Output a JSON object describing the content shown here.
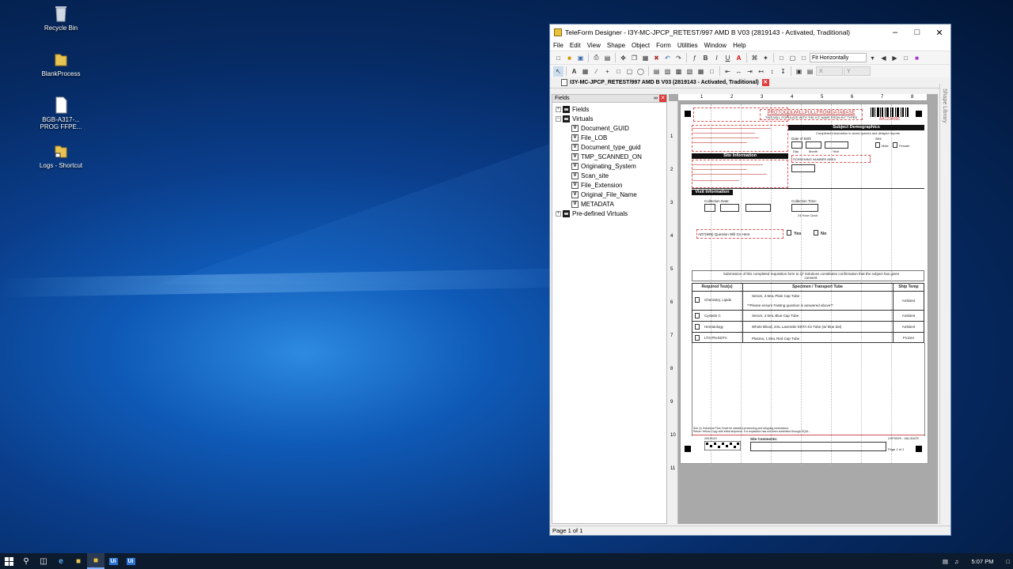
{
  "desktop": {
    "icons": [
      {
        "label": "Recycle Bin"
      },
      {
        "label": "BlankProcess"
      },
      {
        "label": "BGB-A317-... PROG FFPE..."
      },
      {
        "label": "Logs - Shortcut"
      }
    ]
  },
  "window": {
    "title": "TeleForm Designer - I3Y-MC-JPCP_RETEST/997 AMD B V03 (2819143 - Activated, Traditional)",
    "menu": [
      "File",
      "Edit",
      "View",
      "Shape",
      "Object",
      "Form",
      "Utilities",
      "Window",
      "Help"
    ],
    "zoom": "Fit Horizontally",
    "x_label": "X",
    "y_label": "Y",
    "doc_tab": "I3Y-MC-JPCP_RETEST/997 AMD B V03 (2819143 - Activated, Traditional)",
    "status": "Page 1 of 1",
    "shape_library": "Shape Library"
  },
  "fields_panel": {
    "title": "Fields",
    "tree": [
      {
        "label": "Fields",
        "type": "group"
      },
      {
        "label": "Virtuals",
        "type": "group"
      },
      {
        "label": "Document_GUID",
        "type": "virtual"
      },
      {
        "label": "File_LOB",
        "type": "virtual"
      },
      {
        "label": "Document_type_guid",
        "type": "virtual"
      },
      {
        "label": "TMP_SCANNED_ON",
        "type": "virtual"
      },
      {
        "label": "Originating_System",
        "type": "virtual"
      },
      {
        "label": "Scan_site",
        "type": "virtual"
      },
      {
        "label": "File_Extension",
        "type": "virtual"
      },
      {
        "label": "Original_File_Name",
        "type": "virtual"
      },
      {
        "label": "METADATA",
        "type": "virtual"
      },
      {
        "label": "Pre-defined Virtuals",
        "type": "group"
      }
    ]
  },
  "ruler": {
    "h": [
      "1",
      "2",
      "3",
      "4",
      "5",
      "6",
      "7",
      "8"
    ],
    "v": [
      "1",
      "2",
      "3",
      "4",
      "5",
      "6",
      "7",
      "8",
      "9",
      "10",
      "11"
    ]
  },
  "form": {
    "protocol": "PROTOCOLWILLPULLFROMDATABASE",
    "kit_note": "THIS WILL POPULATE WITH THE KIT NAME FROM KIT TYPES",
    "barcode_text": "AA1234566",
    "subject_demographics": "Subject Demographics",
    "demo_note": "Completed information to avoid queries and delayed reports",
    "dob": "Date of Birth",
    "dob_parts": [
      "Day",
      "Month",
      "Year"
    ],
    "sex": "Sex",
    "male": "Male",
    "female": "Female",
    "site_information": "Site Information",
    "screening": "SCREENING NUMBER AREA",
    "visit_information": "Visit Information",
    "collection_date": "Collection Date:",
    "collection_time": "Collection Time:",
    "time_note": "24 Hour Clock",
    "question": "ADT(999) Question Will Go Here",
    "yes": "Yes",
    "no": "No",
    "consent": "Submission of this completed requisition form to Q² Solutions constitutes confirmation that the subject has given consent.",
    "table_headers": [
      "Required Test(s)",
      "Specimen / Transport Tube",
      "Ship Temp"
    ],
    "rows": [
      {
        "test": "Chemistry, Lipids",
        "tube": "Serum, 2.5mL Plain Cap Tube",
        "note": "**Please ensure Fasting question is answered above**",
        "temp": "Ambient"
      },
      {
        "test": "Cystatin C",
        "tube": "Serum, 2.5mL Blue Cap Tube",
        "note": "",
        "temp": "Ambient"
      },
      {
        "test": "Hematology",
        "tube": "Whole Blood, 2mL Lavender EDTA K2 Tube (w/ blue dot)",
        "note": "",
        "temp": "Ambient"
      },
      {
        "test": "LTS-PN-EDTA",
        "tube": "Plasma, 1.8mL Red Cap Tube",
        "note": "",
        "temp": "Frozen"
      }
    ],
    "footer1": "See Q² Solutions Flow Chart for detailed processing and shipping instructions.",
    "footer2": "Return Yellow Copy with initial shipment. If a requisition has not been submitted through SQUI...",
    "form_id": "2819143",
    "site_comments": "Site Comments:",
    "page_no": "Page 1 of 1",
    "version": "LNP9999 - VALIDATE"
  },
  "taskbar": {
    "time": "5:07 PM",
    "ui1": "Ui",
    "ui2": "Ui"
  }
}
